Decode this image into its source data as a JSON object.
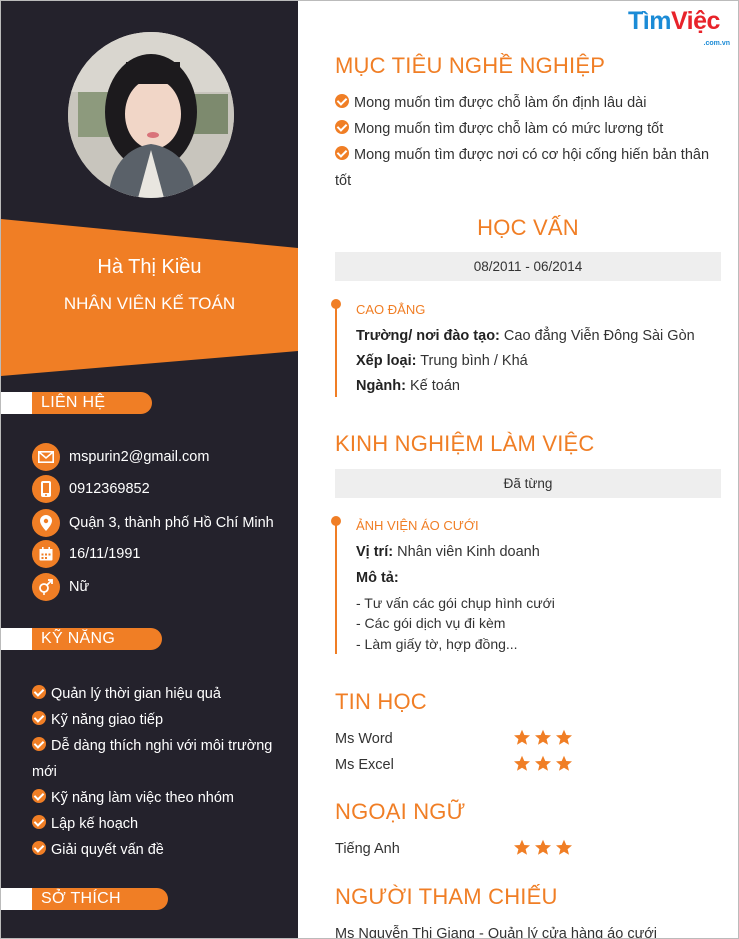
{
  "profile": {
    "name": "Hà Thị Kiều",
    "job_title": "NHÂN VIÊN KẾ TOÁN"
  },
  "logo": {
    "part1": "Tìm",
    "part2": "Việc",
    "sub": ".com.vn"
  },
  "contact": {
    "heading": "LIÊN HỆ",
    "email": "mspurin2@gmail.com",
    "phone": "0912369852",
    "address": "Quận 3, thành phố Hồ Chí Minh",
    "birthday": "16/11/1991",
    "gender": "Nữ"
  },
  "skills": {
    "heading": "KỸ NĂNG",
    "items": [
      "Quản lý thời gian hiệu quả",
      "Kỹ năng giao tiếp",
      "Dễ dàng thích nghi với môi trường mới",
      "Kỹ năng làm việc theo nhóm",
      "Lập kế hoạch",
      "Giải quyết vấn đề"
    ]
  },
  "hobbies": {
    "heading": "SỞ THÍCH"
  },
  "objective": {
    "heading": "MỤC TIÊU NGHỀ NGHIỆP",
    "items": [
      "Mong muốn tìm được chỗ làm ổn định lâu dài",
      "Mong muốn tìm được chỗ làm có mức lương tốt",
      "Mong muốn tìm được nơi có cơ hội cống hiến bản thân tốt"
    ]
  },
  "education": {
    "heading": "HỌC VẤN",
    "period": "08/2011 - 06/2014",
    "degree": "CAO ĐẲNG",
    "school_label": "Trường/ nơi đào tạo:",
    "school": "Cao đẳng Viễn Đông Sài Gòn",
    "rank_label": "Xếp loại:",
    "rank": "Trung bình / Khá",
    "major_label": "Ngành:",
    "major": "Kế toán"
  },
  "experience": {
    "heading": "KINH NGHIỆM LÀM VIỆC",
    "period": "Đã từng",
    "company": "ẢNH VIỆN ÁO CƯỚI",
    "position_label": "Vị trí:",
    "position": "Nhân viên Kinh doanh",
    "desc_label": "Mô tả:",
    "desc": [
      "- Tư vấn các gói chụp hình cưới",
      "- Các gói dịch vụ đi kèm",
      "- Làm giấy tờ, hợp đồng..."
    ]
  },
  "it_skills": {
    "heading": "TIN HỌC",
    "items": [
      {
        "label": "Ms Word",
        "stars": 3
      },
      {
        "label": "Ms Excel",
        "stars": 3
      }
    ]
  },
  "languages": {
    "heading": "NGOẠI NGỮ",
    "items": [
      {
        "label": "Tiếng Anh",
        "stars": 3
      }
    ]
  },
  "references": {
    "heading": "NGƯỜI THAM CHIẾU",
    "first": "Ms Nguyễn Thị Giang - Quản lý cửa hàng áo cưới"
  },
  "colors": {
    "accent": "#f07e25",
    "sidebar": "#24222c",
    "date_bar": "#eeeeee"
  }
}
